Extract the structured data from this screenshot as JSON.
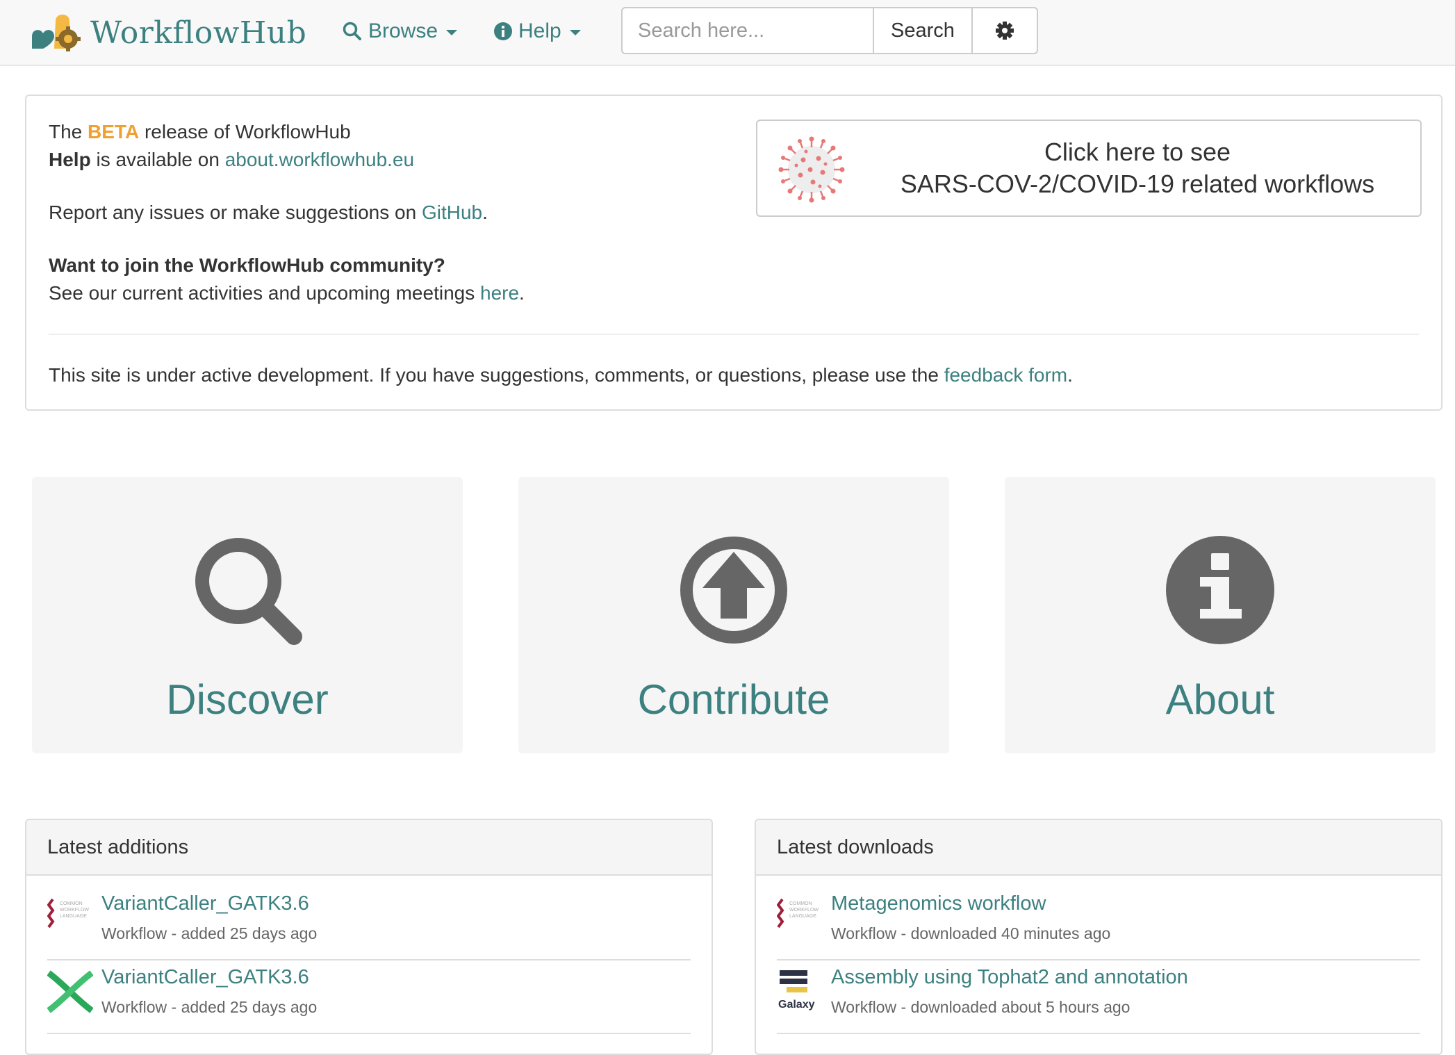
{
  "brand": {
    "name": "WorkflowHub"
  },
  "nav": {
    "browse_label": "Browse",
    "help_label": "Help",
    "search_placeholder": "Search here...",
    "search_button": "Search"
  },
  "notice": {
    "line1_pre": "The ",
    "line1_beta": "BETA",
    "line1_post": " release of WorkflowHub",
    "line2_bold": "Help",
    "line2_mid": " is available on ",
    "line2_link": "about.workflowhub.eu",
    "line3_pre": "Report any issues or make suggestions on ",
    "line3_link": "GitHub",
    "line3_post": ".",
    "line4_bold": "Want to join the WorkflowHub community?",
    "line5_pre": "See our current activities and upcoming meetings ",
    "line5_link": "here",
    "line5_post": ".",
    "footer_pre": "This site is under active development. If you have suggestions, comments, or questions, please use the ",
    "footer_link": "feedback form",
    "footer_post": "."
  },
  "covid_banner": {
    "line1": "Click here to see",
    "line2": "SARS-COV-2/COVID-19 related workflows"
  },
  "tiles": {
    "discover": "Discover",
    "contribute": "Contribute",
    "about": "About"
  },
  "latest_additions": {
    "title": "Latest additions",
    "items": [
      {
        "title": "VariantCaller_GATK3.6",
        "subtitle": "Workflow - added 25 days ago",
        "icon": "cwl-logo"
      },
      {
        "title": "VariantCaller_GATK3.6",
        "subtitle": "Workflow - added 25 days ago",
        "icon": "nextflow-logo"
      }
    ]
  },
  "latest_downloads": {
    "title": "Latest downloads",
    "items": [
      {
        "title": "Metagenomics workflow",
        "subtitle": "Workflow - downloaded 40 minutes ago",
        "icon": "cwl-logo"
      },
      {
        "title": "Assembly using Tophat2 and annotation",
        "subtitle": "Workflow - downloaded about 5 hours ago",
        "icon": "galaxy-logo",
        "icon_text": "Galaxy"
      }
    ]
  },
  "colors": {
    "link": "#3c8080",
    "beta": "#f0a030",
    "icon_gray": "#666666",
    "tile_bg": "#f5f5f5"
  }
}
